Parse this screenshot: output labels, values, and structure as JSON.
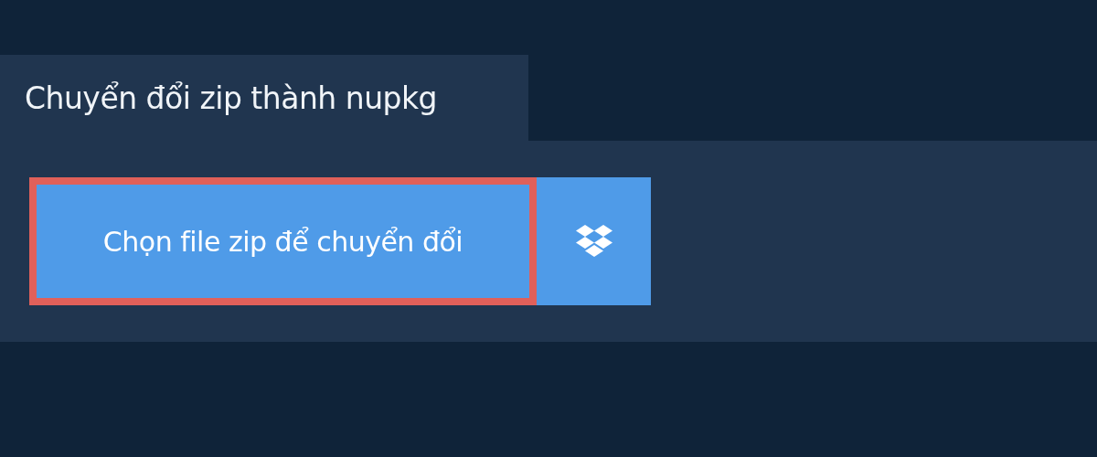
{
  "tab": {
    "label": "Chuyển đổi zip thành nupkg"
  },
  "upload_button": {
    "label": "Chọn file zip để chuyển đổi",
    "focused": true
  },
  "cloud_button": {
    "kind": "cloud"
  }
}
